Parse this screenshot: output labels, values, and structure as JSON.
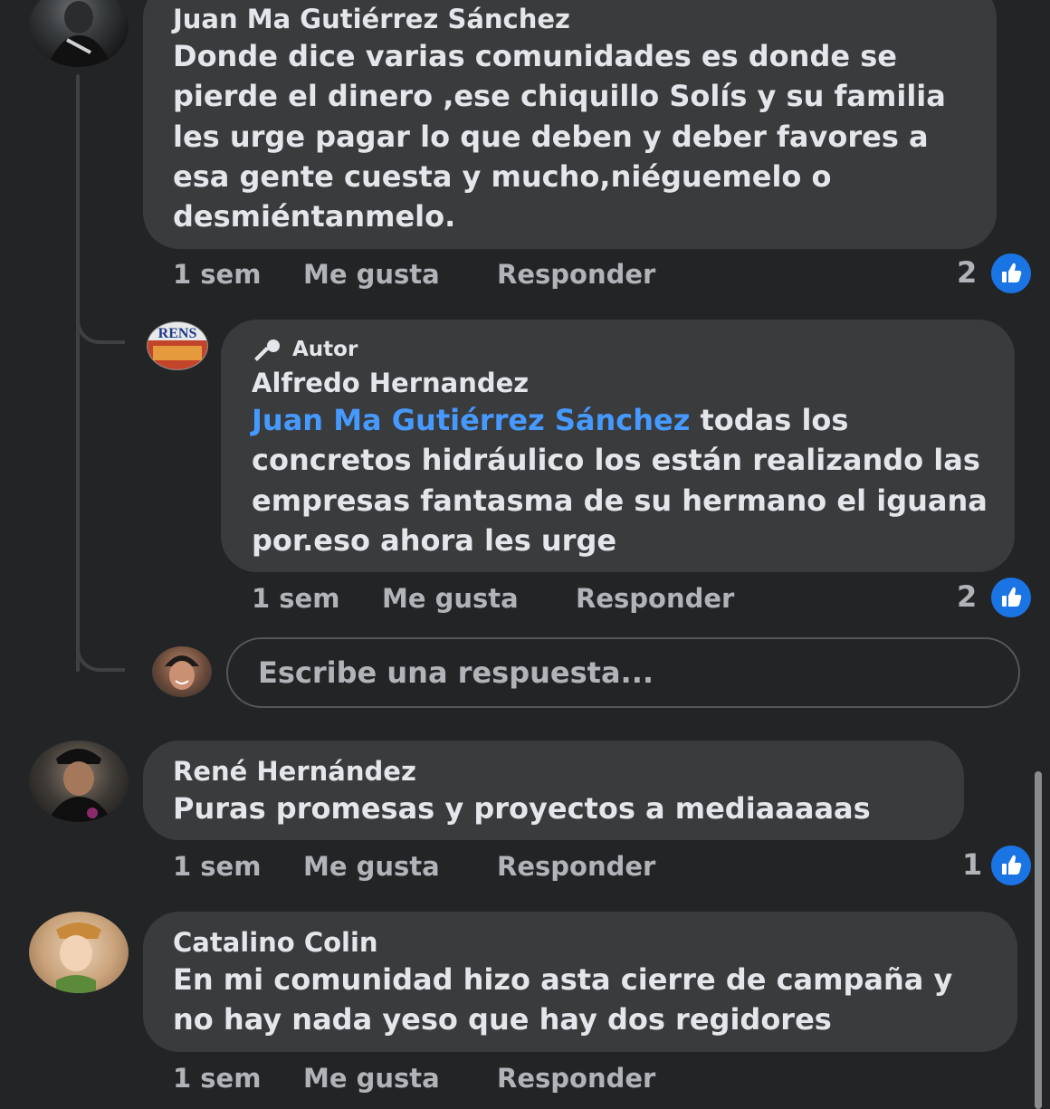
{
  "comments": [
    {
      "author": "Juan Ma Gutiérrez Sánchez",
      "text": "Donde dice varias comunidades es donde se pierde el dinero ,ese chiquillo  Solís y su familia les urge pagar lo que deben y deber favores a esa gente cuesta y mucho,niéguemelo o desmiéntanmelo.",
      "time": "1 sem",
      "like_label": "Me gusta",
      "reply_label": "Responder",
      "likes": "2",
      "reply": {
        "badge": "Autor",
        "author": "Alfredo Hernandez",
        "mention": "Juan Ma Gutiérrez Sánchez",
        "text": " todas los concretos hidráulico los están realizando las empresas fantasma de su hermano el iguana por.eso ahora les urge",
        "time": "1 sem",
        "like_label": "Me gusta",
        "reply_label": "Responder",
        "likes": "2"
      },
      "reply_input": {
        "placeholder": "Escribe una respuesta..."
      }
    },
    {
      "author": "René Hernández",
      "text": "Puras promesas y proyectos a mediaaaaas",
      "time": "1 sem",
      "like_label": "Me gusta",
      "reply_label": "Responder",
      "likes": "1"
    },
    {
      "author": "Catalino Colin",
      "text": "En mi comunidad hizo asta cierre de campaña y no hay nada yeso que hay dos regidores",
      "time": "1 sem",
      "like_label": "Me gusta",
      "reply_label": "Responder"
    }
  ],
  "colors": {
    "background": "#232426",
    "bubble": "#3a3b3c",
    "mention": "#4599ff",
    "like_blue": "#1b74e4",
    "meta_text": "#b0b3b8"
  },
  "icons": {
    "like": "thumbs-up-icon",
    "author_badge": "microphone-icon"
  }
}
